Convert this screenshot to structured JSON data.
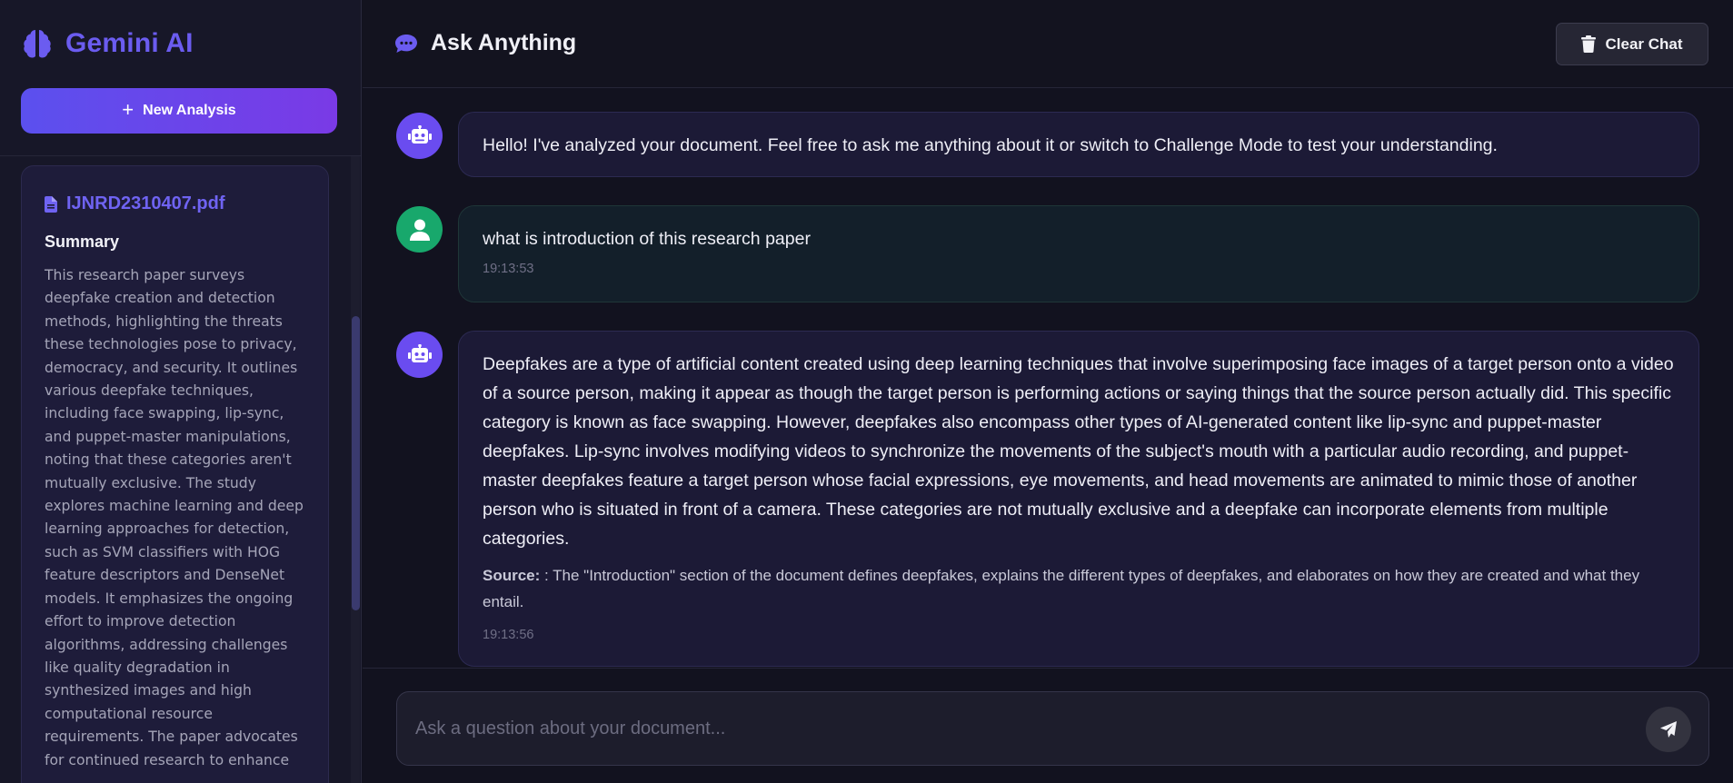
{
  "sidebar": {
    "brand_title": "Gemini AI",
    "brand_icon": "brain-icon",
    "new_analysis_label": "New Analysis",
    "document": {
      "file_name": "IJNRD2310407.pdf",
      "summary_heading": "Summary",
      "summary_text": "This research paper surveys deepfake creation and detection methods, highlighting the threats these technologies pose to privacy, democracy, and security. It outlines various deepfake techniques, including face swapping, lip-sync, and puppet-master manipulations, noting that these categories aren't mutually exclusive. The study explores machine learning and deep learning approaches for detection, such as SVM classifiers with HOG feature descriptors and DenseNet models. It emphasizes the ongoing effort to improve detection algorithms, addressing challenges like quality degradation in synthesized images and high computational resource requirements. The paper advocates for continued research to enhance"
    }
  },
  "header": {
    "title": "Ask Anything",
    "clear_label": "Clear Chat"
  },
  "messages": [
    {
      "role": "bot",
      "text": "Hello! I've analyzed your document. Feel free to ask me anything about it or switch to Challenge Mode to test your understanding."
    },
    {
      "role": "user",
      "text": "what is introduction of this research paper",
      "time": "19:13:53"
    },
    {
      "role": "bot",
      "text": "Deepfakes are a type of artificial content created using deep learning techniques that involve superimposing face images of a target person onto a video of a source person, making it appear as though the target person is performing actions or saying things that the source person actually did. This specific category is known as face swapping. However, deepfakes also encompass other types of AI-generated content like lip-sync and puppet-master deepfakes. Lip-sync involves modifying videos to synchronize the movements of the subject's mouth with a particular audio recording, and puppet-master deepfakes feature a target person whose facial expressions, eye movements, and head movements are animated to mimic those of another person who is situated in front of a camera. These categories are not mutually exclusive and a deepfake can incorporate elements from multiple categories.",
      "source_label": "Source:",
      "source_text": " : The \"Introduction\" section of the document defines deepfakes, explains the different types of deepfakes, and elaborates on how they are created and what they entail.",
      "time": "19:13:56"
    }
  ],
  "composer": {
    "placeholder": "Ask a question about your document..."
  },
  "colors": {
    "accent": "#6b5cf0",
    "user_avatar": "#18a86c",
    "bot_avatar": "#6a4cf0"
  }
}
